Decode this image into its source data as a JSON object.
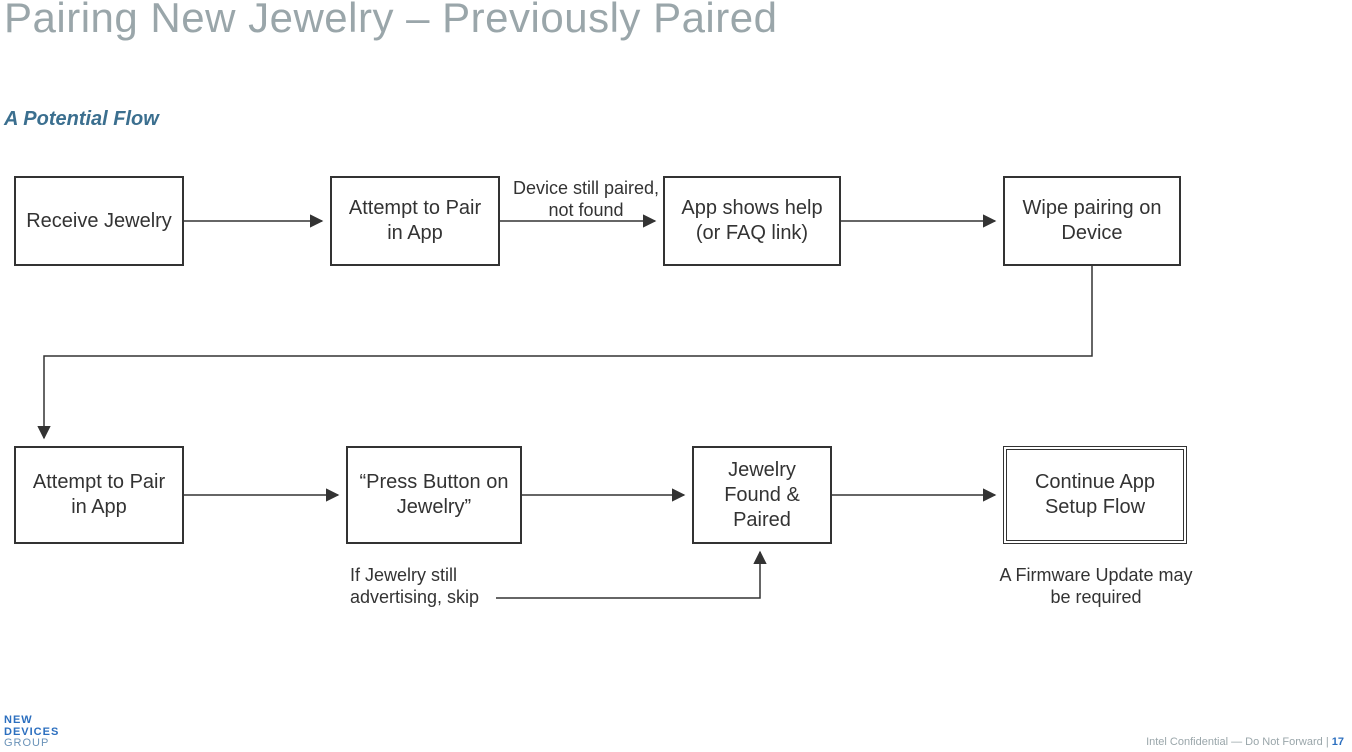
{
  "title": "Pairing New Jewelry – Previously Paired",
  "subtitle": "A Potential Flow",
  "boxes": {
    "b1": "Receive Jewelry",
    "b2": "Attempt to Pair in App",
    "b3": "App shows help\n(or FAQ link)",
    "b4": "Wipe pairing on Device",
    "b5": "Attempt to Pair in App",
    "b6": "“Press Button on Jewelry”",
    "b7": "Jewelry Found & Paired",
    "b8": "Continue App Setup Flow"
  },
  "annotations": {
    "a1": "Device still paired,\nnot found",
    "a2": "If Jewelry still advertising, skip",
    "a3": "A Firmware Update may be required"
  },
  "logo": {
    "l1": "NEW",
    "l2": "DEVICES",
    "l3": "GROUP"
  },
  "footer": {
    "text": "Intel Confidential — Do Not Forward  | ",
    "page": "17"
  }
}
